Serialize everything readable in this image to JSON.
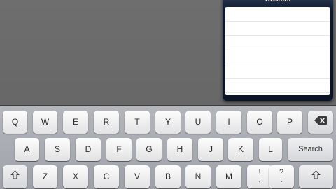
{
  "results_popover": {
    "title": "Results",
    "rows": [
      "",
      "",
      "",
      "",
      "",
      ""
    ]
  },
  "keyboard": {
    "row1": [
      "Q",
      "W",
      "E",
      "R",
      "T",
      "Y",
      "U",
      "I",
      "O",
      "P"
    ],
    "row2": [
      "A",
      "S",
      "D",
      "F",
      "G",
      "H",
      "J",
      "K",
      "L"
    ],
    "row3": [
      "Z",
      "X",
      "C",
      "V",
      "B",
      "N",
      "M"
    ],
    "punct_left": {
      "top": "!",
      "bottom": ","
    },
    "punct_right": {
      "top": "?",
      "bottom": "."
    },
    "search_label": "Search",
    "icons": {
      "backspace": "backspace-icon",
      "shift_left": "shift-icon",
      "shift_right": "shift-icon"
    }
  }
}
